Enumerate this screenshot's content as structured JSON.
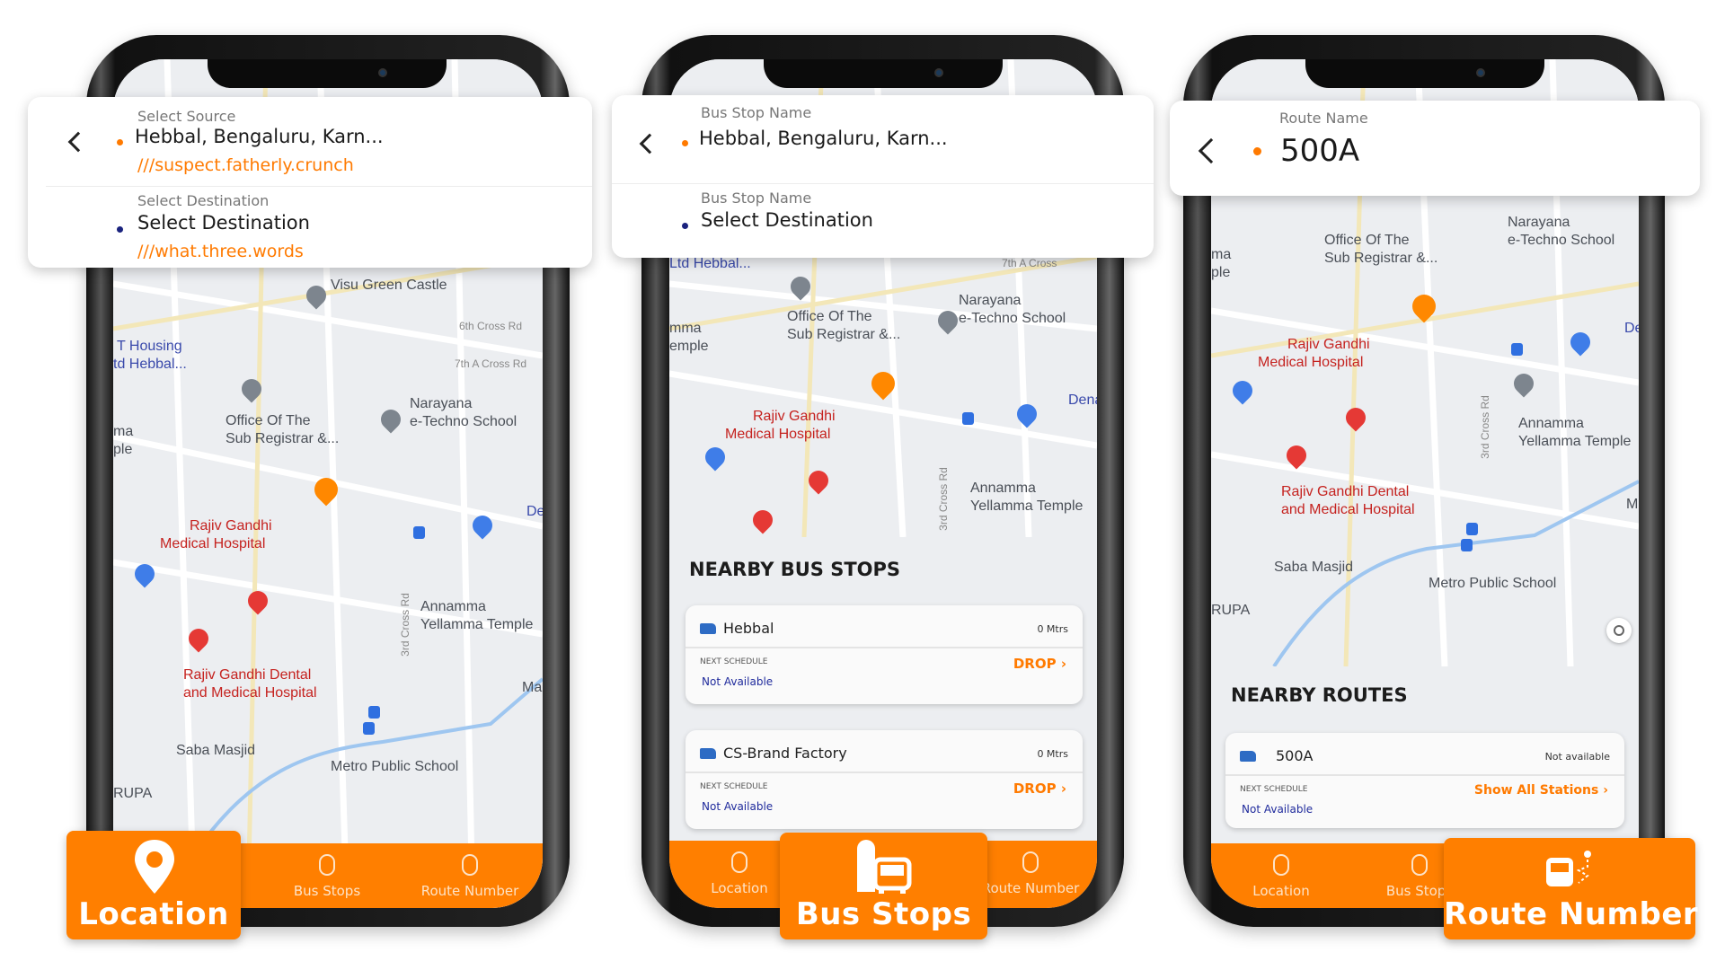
{
  "colors": {
    "accent": "#ff7f00",
    "destination_dot": "#1a237e",
    "not_available": "#1f2a9c"
  },
  "phone1": {
    "header": {
      "back_icon": "chevron-left-icon",
      "source_label": "Select Source",
      "source_value": "Hebbal, Bengaluru, Karn...",
      "source_w3w": "///suspect.fatherly.crunch",
      "dest_label": "Select Destination",
      "dest_value": "Select Destination",
      "dest_w3w": "///what.three.words"
    },
    "map_labels": [
      "Visu Green Castle",
      "T Housing",
      "td Hebbal...",
      "Office Of The",
      "Sub Registrar &...",
      "Narayana",
      "e-Techno School",
      "Rajiv Gandhi",
      "Medical Hospital",
      "Annamma",
      "Yellamma Temple",
      "Rajiv Gandhi Dental",
      "and Medical Hospital",
      "Saba Masjid",
      "Metro Public School",
      "RUPA",
      "6th Cross Rd",
      "7th A Cross Rd",
      "3rd Cross Rd",
      "ma",
      "ple",
      "De",
      "Ma"
    ],
    "nav": [
      "Location",
      "Bus Stops",
      "Route Number"
    ],
    "badge": "Location"
  },
  "phone2": {
    "header": {
      "back_icon": "chevron-left-icon",
      "source_label": "Bus Stop Name",
      "source_value": "Hebbal, Bengaluru, Karn...",
      "dest_label": "Bus Stop Name",
      "dest_value": "Select Destination"
    },
    "map_labels": [
      "Ltd Hebbal...",
      "Office Of The",
      "Sub Registrar &...",
      "Narayana",
      "e-Techno School",
      "mma",
      "emple",
      "Rajiv Gandhi",
      "Medical Hospital",
      "Annamma",
      "Yellamma Temple",
      "3rd Cross Rd",
      "7th A Cross",
      "Dena"
    ],
    "section_title": "NEARBY BUS STOPS",
    "stops": [
      {
        "name": "Hebbal",
        "distance": "0 Mtrs",
        "schedule_label": "NEXT SCHEDULE",
        "schedule": "Not Available",
        "action": "DROP"
      },
      {
        "name": "CS-Brand Factory",
        "distance": "0 Mtrs",
        "schedule_label": "NEXT SCHEDULE",
        "schedule": "Not Available",
        "action": "DROP"
      }
    ],
    "nav": [
      "Location",
      "Bus Stops",
      "Route Number"
    ],
    "badge": "Bus Stops"
  },
  "phone3": {
    "header": {
      "back_icon": "chevron-left-icon",
      "route_label": "Route Name",
      "route_value": "500A"
    },
    "map_labels": [
      "Office Of The",
      "Sub Registrar &...",
      "Narayana",
      "e-Techno School",
      "ma",
      "ple",
      "Rajiv Gandhi",
      "Medical Hospital",
      "Annamma",
      "Yellamma Temple",
      "Rajiv Gandhi Dental",
      "and Medical Hospital",
      "Saba Masjid",
      "Metro Public School",
      "RUPA",
      "3rd Cross Rd",
      "De",
      "Ma"
    ],
    "section_title": "NEARBY ROUTES",
    "routes": [
      {
        "name": "500A",
        "status": "Not available",
        "schedule_label": "NEXT SCHEDULE",
        "schedule": "Not Available",
        "action": "Show All Stations"
      }
    ],
    "nav": [
      "Location",
      "Bus Stops",
      "Route Number"
    ],
    "badge": "Route Number"
  }
}
